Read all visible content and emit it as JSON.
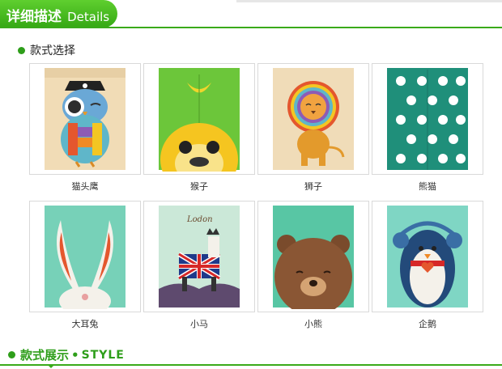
{
  "header": {
    "title_cn": "详细描述",
    "title_en": "Details"
  },
  "section": {
    "title": "款式选择"
  },
  "products": [
    {
      "label": "猫头鹰",
      "icon": "owl-icon"
    },
    {
      "label": "猴子",
      "icon": "monkey-icon"
    },
    {
      "label": "狮子",
      "icon": "lion-icon"
    },
    {
      "label": "熊猫",
      "icon": "panda-icon"
    },
    {
      "label": "大耳兔",
      "icon": "rabbit-icon"
    },
    {
      "label": "小马",
      "icon": "pony-icon"
    },
    {
      "label": "小熊",
      "icon": "bear-icon"
    },
    {
      "label": "企鹅",
      "icon": "penguin-icon"
    }
  ],
  "product_art": {
    "pony_text": "Lodon"
  },
  "footer": {
    "title_cn": "款式展示",
    "separator": "•",
    "title_en": "STYLE"
  },
  "colors": {
    "accent_green": "#3aaa1a",
    "tab_green": "#4cbf22"
  }
}
